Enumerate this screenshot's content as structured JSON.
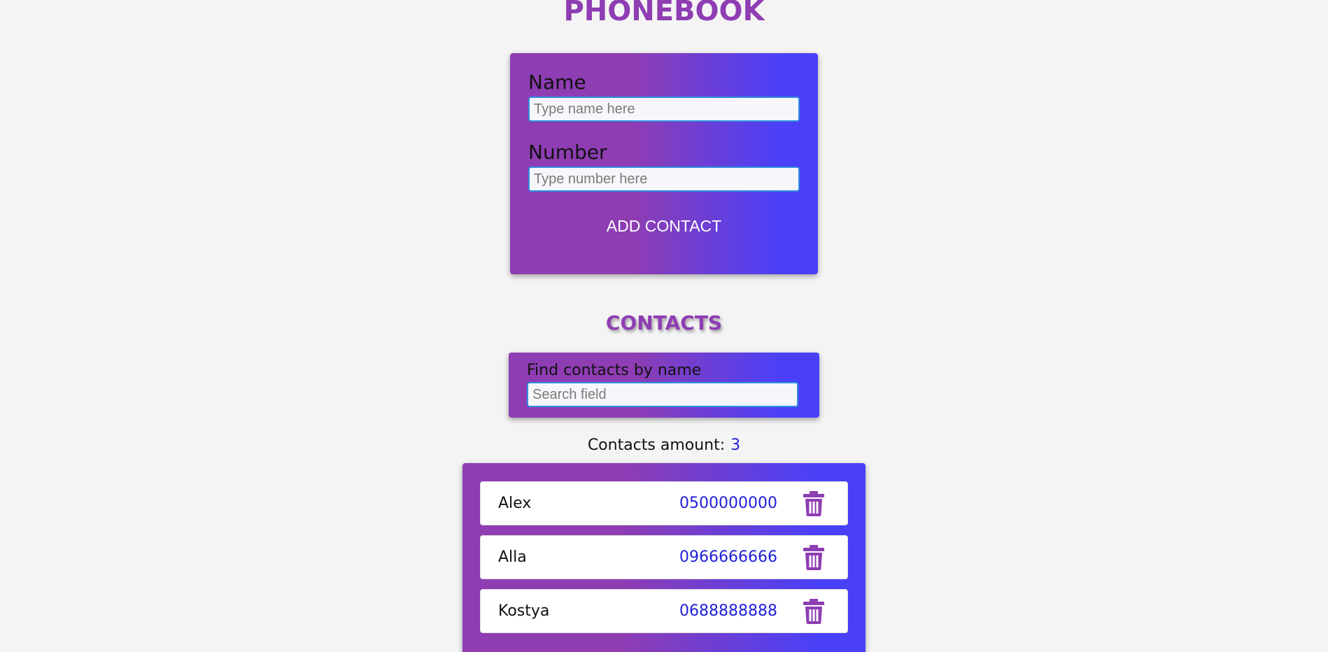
{
  "app": {
    "title": "PHONEBOOK"
  },
  "form": {
    "name_label": "Name",
    "name_placeholder": "Type name here",
    "name_value": "",
    "number_label": "Number",
    "number_placeholder": "Type number here",
    "number_value": "",
    "submit_label": "ADD CONTACT"
  },
  "contacts_section": {
    "title": "CONTACTS",
    "filter_label": "Find contacts by name",
    "filter_placeholder": "Search field",
    "filter_value": "",
    "amount_label": "Contacts amount:",
    "amount_value": "3"
  },
  "contacts": [
    {
      "name": "Alex",
      "number": "0500000000",
      "delete_icon": "trash-icon"
    },
    {
      "name": "Alla",
      "number": "0966666666",
      "delete_icon": "trash-icon"
    },
    {
      "name": "Kostya",
      "number": "0688888888",
      "delete_icon": "trash-icon"
    }
  ],
  "colors": {
    "accent_purple": "#8e3db3",
    "accent_blue": "#4a40f7",
    "number_blue": "#2020d8",
    "input_border": "#2f8fe0",
    "background": "#f4f4f4"
  }
}
